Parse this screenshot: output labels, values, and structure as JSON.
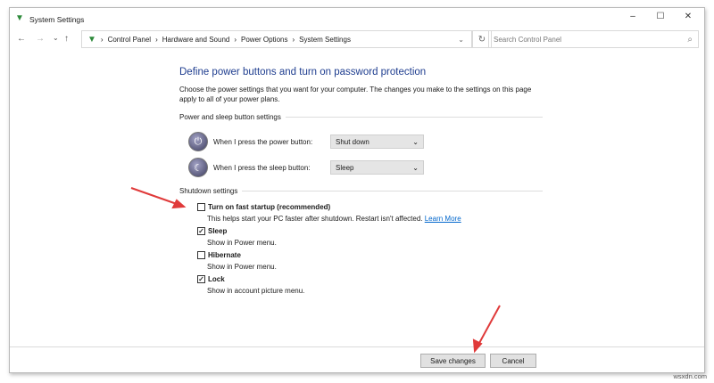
{
  "window": {
    "title": "System Settings",
    "minimize": "–",
    "maximize": "☐",
    "close": "✕"
  },
  "nav": {
    "back": "←",
    "forward": "→",
    "recent": "⌄",
    "up": "↑",
    "breadcrumb": [
      "Control Panel",
      "Hardware and Sound",
      "Power Options",
      "System Settings"
    ],
    "dropdown": "⌄",
    "refresh": "↻"
  },
  "search": {
    "placeholder": "Search Control Panel",
    "icon": "⌕"
  },
  "main": {
    "heading": "Define power buttons and turn on password protection",
    "description": "Choose the power settings that you want for your computer. The changes you make to the settings on this page apply to all of your power plans.",
    "power_section": "Power and sleep button settings",
    "power_button_label": "When I press the power button:",
    "power_button_value": "Shut down",
    "sleep_button_label": "When I press the sleep button:",
    "sleep_button_value": "Sleep",
    "shutdown_section": "Shutdown settings",
    "items": [
      {
        "label": "Turn on fast startup (recommended)",
        "desc": "This helps start your PC faster after shutdown. Restart isn't affected.",
        "checked": false
      },
      {
        "label": "Sleep",
        "desc": "Show in Power menu.",
        "checked": true
      },
      {
        "label": "Hibernate",
        "desc": "Show in Power menu.",
        "checked": false
      },
      {
        "label": "Lock",
        "desc": "Show in account picture menu.",
        "checked": true
      }
    ],
    "learn_more": "Learn More"
  },
  "footer": {
    "save": "Save changes",
    "cancel": "Cancel"
  },
  "watermark": "wsxdn.com",
  "colors": {
    "heading": "#1e3d8f",
    "link": "#0066cc",
    "arrow": "#e03a3a"
  }
}
